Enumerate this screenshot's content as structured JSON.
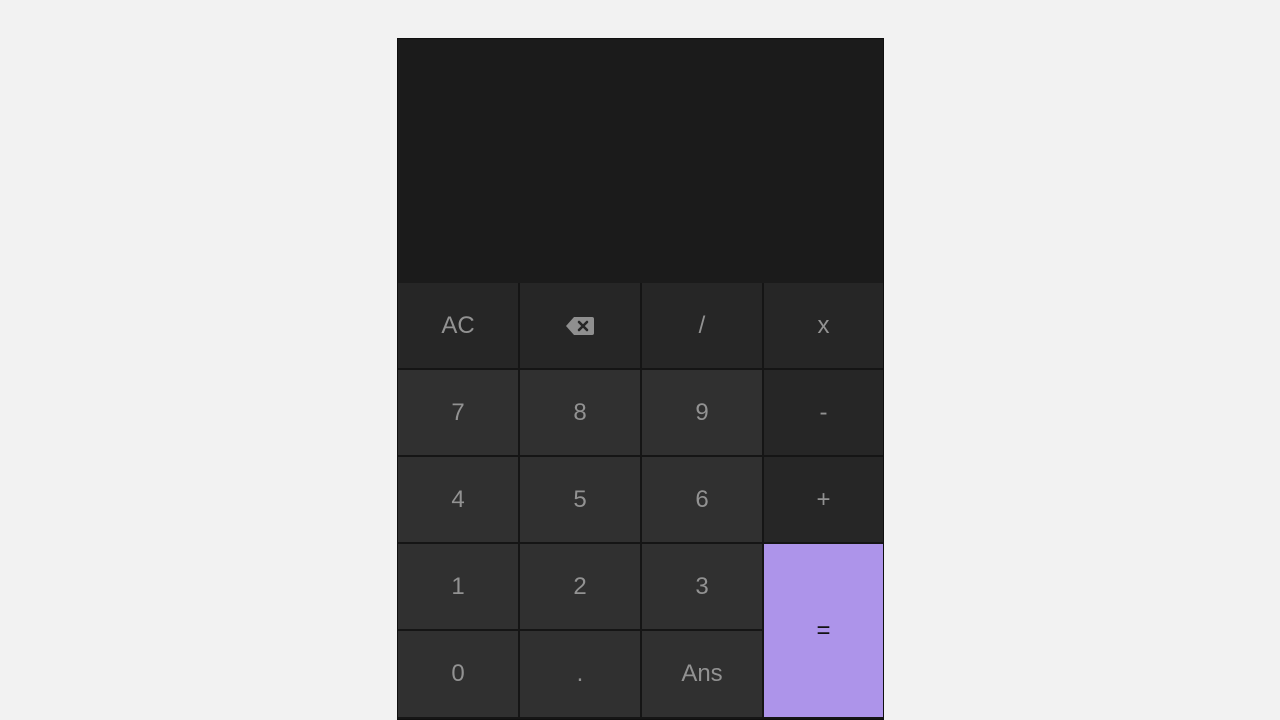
{
  "calculator": {
    "display": {
      "expression": "",
      "result": ""
    },
    "keys": {
      "clear": "AC",
      "backspace_icon": "backspace-icon",
      "divide": "/",
      "multiply": "x",
      "seven": "7",
      "eight": "8",
      "nine": "9",
      "minus": "-",
      "four": "4",
      "five": "5",
      "six": "6",
      "plus": "+",
      "one": "1",
      "two": "2",
      "three": "3",
      "equals": "=",
      "zero": "0",
      "decimal": ".",
      "answer": "Ans"
    },
    "colors": {
      "page_background": "#f2f2f2",
      "display_background": "#1b1b1b",
      "digit_key_background": "#303030",
      "operator_key_background": "#262626",
      "equals_key_background": "#ad94ea",
      "key_text": "#929292"
    }
  }
}
